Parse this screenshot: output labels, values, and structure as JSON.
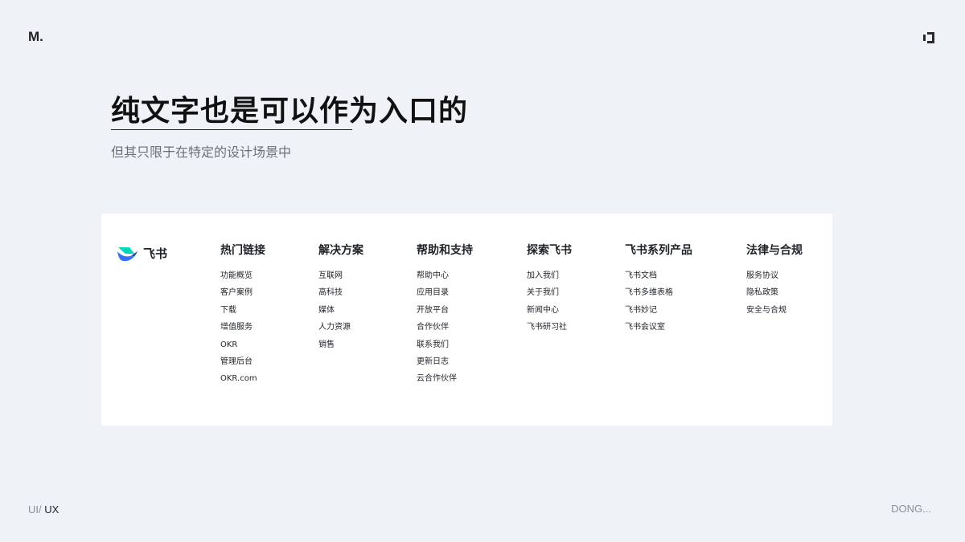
{
  "logo_text": "M.",
  "headline": "纯文字也是可以作为入口的",
  "subtitle": "但其只限于在特定的设计场景中",
  "brand": {
    "name": "飞书",
    "icon": "feishu-logo-icon",
    "accent": "#3370ff"
  },
  "columns": [
    {
      "title": "热门链接",
      "items": [
        "功能概览",
        "客户案例",
        "下载",
        "增值服务",
        "OKR",
        "管理后台",
        "OKR.com"
      ]
    },
    {
      "title": "解决方案",
      "items": [
        "互联网",
        "高科技",
        "媒体",
        "人力资源",
        "销售"
      ]
    },
    {
      "title": "帮助和支持",
      "items": [
        "帮助中心",
        "应用目录",
        "开放平台",
        "合作伙伴",
        "联系我们",
        "更新日志",
        "云合作伙伴"
      ]
    },
    {
      "title": "探索飞书",
      "items": [
        "加入我们",
        "关于我们",
        "新闻中心",
        "飞书研习社"
      ]
    },
    {
      "title": "飞书系列产品",
      "items": [
        "飞书文档",
        "飞书多维表格",
        "飞书妙记",
        "飞书会议室"
      ]
    },
    {
      "title": "法律与合规",
      "items": [
        "服务协议",
        "隐私政策",
        "安全与合规"
      ]
    }
  ],
  "bottom_left": {
    "part1": "UI/ ",
    "part2": "UX"
  },
  "bottom_right": "DONG..."
}
